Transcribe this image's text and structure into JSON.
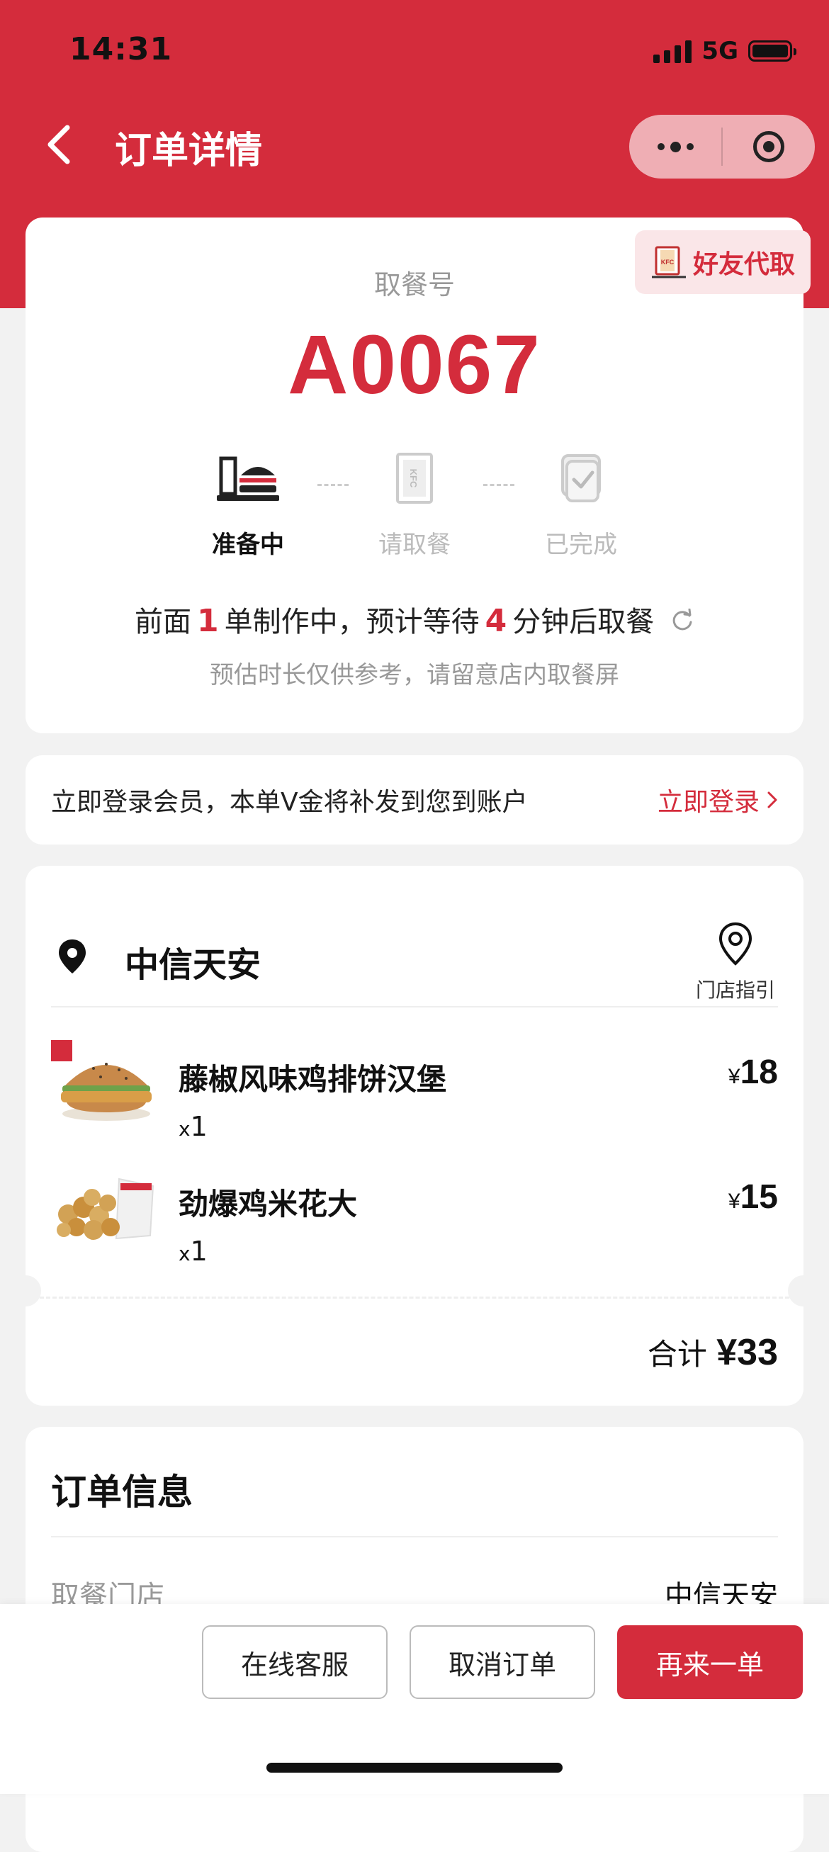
{
  "status_bar": {
    "time": "14:31",
    "network": "5G"
  },
  "nav": {
    "title": "订单详情"
  },
  "pickup": {
    "friend_tag": "好友代取",
    "label": "取餐号",
    "number": "A0067",
    "steps": [
      {
        "label": "准备中",
        "active": true
      },
      {
        "label": "请取餐",
        "active": false
      },
      {
        "label": "已完成",
        "active": false
      }
    ],
    "wait": {
      "prefix": "前面",
      "orders_ahead": "1",
      "middle": "单制作中，预计等待",
      "minutes": "4",
      "suffix": "分钟后取餐"
    },
    "note": "预估时长仅供参考，请留意店内取餐屏"
  },
  "login_banner": {
    "text": "立即登录会员，本单V金将补发到您到账户",
    "link": "立即登录"
  },
  "order": {
    "store_name": "中信天安",
    "store_guide": "门店指引",
    "items": [
      {
        "name": "藤椒风味鸡排饼汉堡",
        "qty_prefix": "x",
        "qty": "1",
        "currency": "¥",
        "price": "18"
      },
      {
        "name": "劲爆鸡米花大",
        "qty_prefix": "x",
        "qty": "1",
        "currency": "¥",
        "price": "15"
      }
    ],
    "total_label": "合计",
    "total_amount": "¥33"
  },
  "info": {
    "title": "订单信息",
    "rows": [
      {
        "key": "取餐门店",
        "value": "中信天安"
      }
    ]
  },
  "actions": {
    "service": "在线客服",
    "cancel": "取消订单",
    "reorder": "再来一单"
  },
  "colors": {
    "brand_red": "#d42c3c",
    "background": "#f2f2f2"
  }
}
